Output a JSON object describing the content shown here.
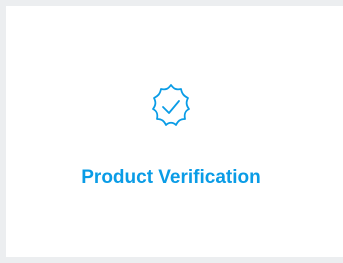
{
  "card": {
    "icon": "verified-badge-icon",
    "title": "Product Verification",
    "accent_color": "#0a9ce6"
  }
}
